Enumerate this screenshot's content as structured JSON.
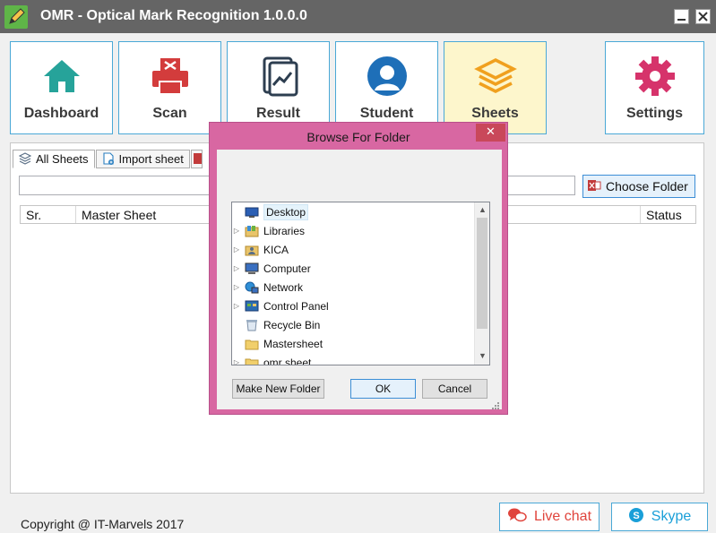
{
  "window": {
    "title": "OMR - Optical Mark Recognition 1.0.0.0"
  },
  "nav": [
    {
      "label": "Dashboard",
      "icon": "home-icon",
      "color": "#26a39a"
    },
    {
      "label": "Scan",
      "icon": "printer-icon",
      "color": "#d33c3c"
    },
    {
      "label": "Result",
      "icon": "chart-document-icon",
      "color": "#2d3e50"
    },
    {
      "label": "Student",
      "icon": "user-icon",
      "color": "#1e6fb8"
    },
    {
      "label": "Sheets",
      "icon": "layers-icon",
      "color": "#f0a01e"
    },
    {
      "label": "Settings",
      "icon": "gear-icon",
      "color": "#d6336b"
    }
  ],
  "tabs": [
    {
      "label": "All Sheets",
      "icon": "layers-icon"
    },
    {
      "label": "Import sheet",
      "icon": "import-icon"
    }
  ],
  "toolbar": {
    "path_value": "",
    "choose_label": "Choose Folder"
  },
  "grid": {
    "columns": [
      "Sr.",
      "Master Sheet",
      "Status"
    ]
  },
  "footer": {
    "copyright": "Copyright @ IT-Marvels 2017",
    "live_chat": "Live chat",
    "skype": "Skype"
  },
  "dialog": {
    "title": "Browse For Folder",
    "close_glyph": "✕",
    "tree": [
      {
        "label": "Desktop",
        "icon": "desktop-icon",
        "arrow": false
      },
      {
        "label": "Libraries",
        "icon": "libraries-icon",
        "arrow": true
      },
      {
        "label": "KICA",
        "icon": "user-folder-icon",
        "arrow": true
      },
      {
        "label": "Computer",
        "icon": "computer-icon",
        "arrow": true
      },
      {
        "label": "Network",
        "icon": "network-icon",
        "arrow": true
      },
      {
        "label": "Control Panel",
        "icon": "control-panel-icon",
        "arrow": true
      },
      {
        "label": "Recycle Bin",
        "icon": "recycle-bin-icon",
        "arrow": false
      },
      {
        "label": "Mastersheet",
        "icon": "folder-icon",
        "arrow": false
      },
      {
        "label": "omr sheet",
        "icon": "folder-icon",
        "arrow": true
      }
    ],
    "buttons": {
      "new_folder": "Make New Folder",
      "ok": "OK",
      "cancel": "Cancel"
    }
  },
  "colors": {
    "titlebar": "#656565",
    "accent": "#4aa8d6",
    "dialog_frame": "#d867a2",
    "active_tab": "#fdf6cc"
  }
}
